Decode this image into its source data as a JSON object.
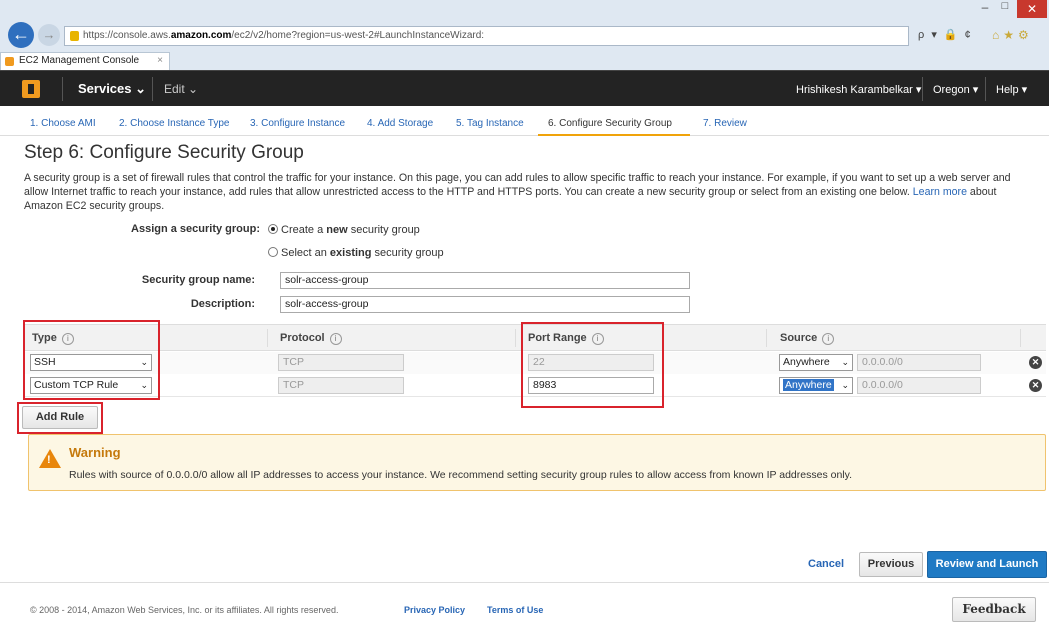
{
  "browser": {
    "url_prefix": "https://console.aws.",
    "url_domain": "amazon.com",
    "url_rest": "/ec2/v2/home?region=us-west-2#LaunchInstanceWizard:",
    "search_symbol": "ρ ▾ 🔒 ¢",
    "tab_title": "EC2 Management Console",
    "tab_close": "×"
  },
  "aws_header": {
    "services_label": "Services ⌄",
    "edit_label": "Edit ⌄",
    "user_label": "Hrishikesh Karambelkar ▾",
    "region_label": "Oregon ▾",
    "help_label": "Help ▾"
  },
  "wizard_steps": [
    "1. Choose AMI",
    "2. Choose Instance Type",
    "3. Configure Instance",
    "4. Add Storage",
    "5. Tag Instance",
    "6. Configure Security Group",
    "7. Review"
  ],
  "page": {
    "title": "Step 6: Configure Security Group",
    "description": "A security group is a set of firewall rules that control the traffic for your instance. On this page, you can add rules to allow specific traffic to reach your instance. For example, if you want to set up a web server and allow Internet traffic to reach your instance, add rules that allow unrestricted access to the HTTP and HTTPS ports. You can create a new security group or select from an existing one below.",
    "learn_more": "Learn more",
    "learn_more_suffix": "about Amazon EC2 security groups."
  },
  "form": {
    "assign_label": "Assign a security group:",
    "option_create_pre": "Create a ",
    "option_create_bold": "new",
    "option_create_post": " security group",
    "option_select_pre": "Select an ",
    "option_select_bold": "existing",
    "option_select_post": " security group",
    "name_label": "Security group name:",
    "name_value": "solr-access-group",
    "description_label": "Description:",
    "description_value": "solr-access-group"
  },
  "table": {
    "headers": {
      "type": "Type",
      "protocol": "Protocol",
      "port_range": "Port Range",
      "source": "Source"
    },
    "info_symbol": "i",
    "rows": [
      {
        "type": "SSH",
        "protocol": "TCP",
        "port": "22",
        "source": "Anywhere",
        "cidr": "0.0.0.0/0"
      },
      {
        "type": "Custom TCP Rule",
        "protocol": "TCP",
        "port": "8983",
        "source": "Anywhere",
        "cidr": "0.0.0.0/0"
      }
    ],
    "caret": "⌄",
    "remove_symbol": "✕"
  },
  "add_rule_label": "Add Rule",
  "warning": {
    "title": "Warning",
    "text": "Rules with source of 0.0.0.0/0 allow all IP addresses to access your instance. We recommend setting security group rules to allow access from known IP addresses only."
  },
  "actions": {
    "cancel": "Cancel",
    "previous": "Previous",
    "review_launch": "Review and Launch"
  },
  "footer": {
    "copyright": "© 2008 - 2014, Amazon Web Services, Inc. or its affiliates. All rights reserved.",
    "privacy": "Privacy Policy",
    "terms": "Terms of Use",
    "feedback": "Feedback"
  },
  "colors": {
    "accent_orange": "#f09a1f",
    "primary_blue": "#1f7ac4",
    "highlight_red": "#d9232c"
  }
}
